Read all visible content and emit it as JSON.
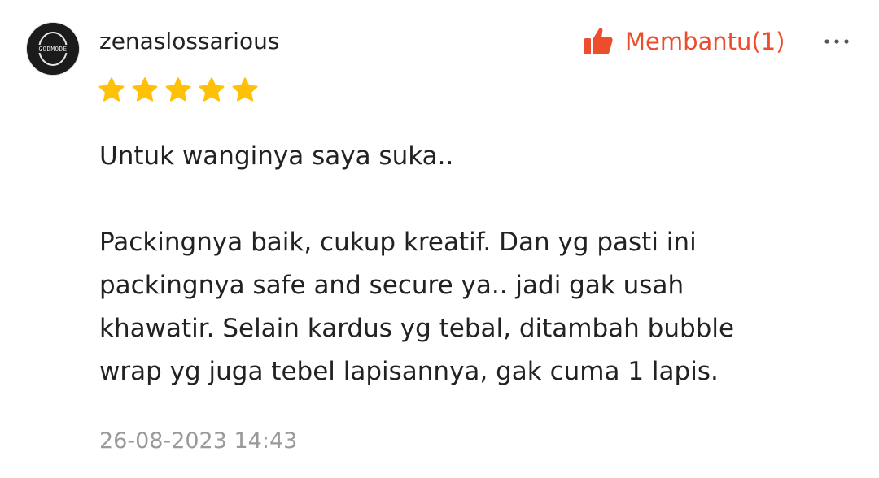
{
  "review": {
    "username": "zenaslossarious",
    "avatar_text": "GODMODE",
    "rating": 5,
    "helpful_label": "Membantu(1)",
    "comment_lines": [
      "Untuk wanginya saya suka..",
      "",
      "Packingnya baik, cukup kreatif. Dan yg pasti ini",
      "packingnya safe and secure ya.. jadi gak usah",
      "khawatir. Selain kardus yg tebal, ditambah bubble",
      "wrap yg juga tebel lapisannya, gak cuma 1 lapis."
    ],
    "date": "26-08-2023 14:43"
  },
  "icons": {
    "avatar": "avatar-logo-icon",
    "helpful": "thumbs-up-icon",
    "more": "more-dots-icon",
    "star": "star-icon"
  },
  "colors": {
    "accent": "#ee4d2d",
    "star": "#ffc107",
    "text": "#222222",
    "muted": "#9a9a9a"
  }
}
